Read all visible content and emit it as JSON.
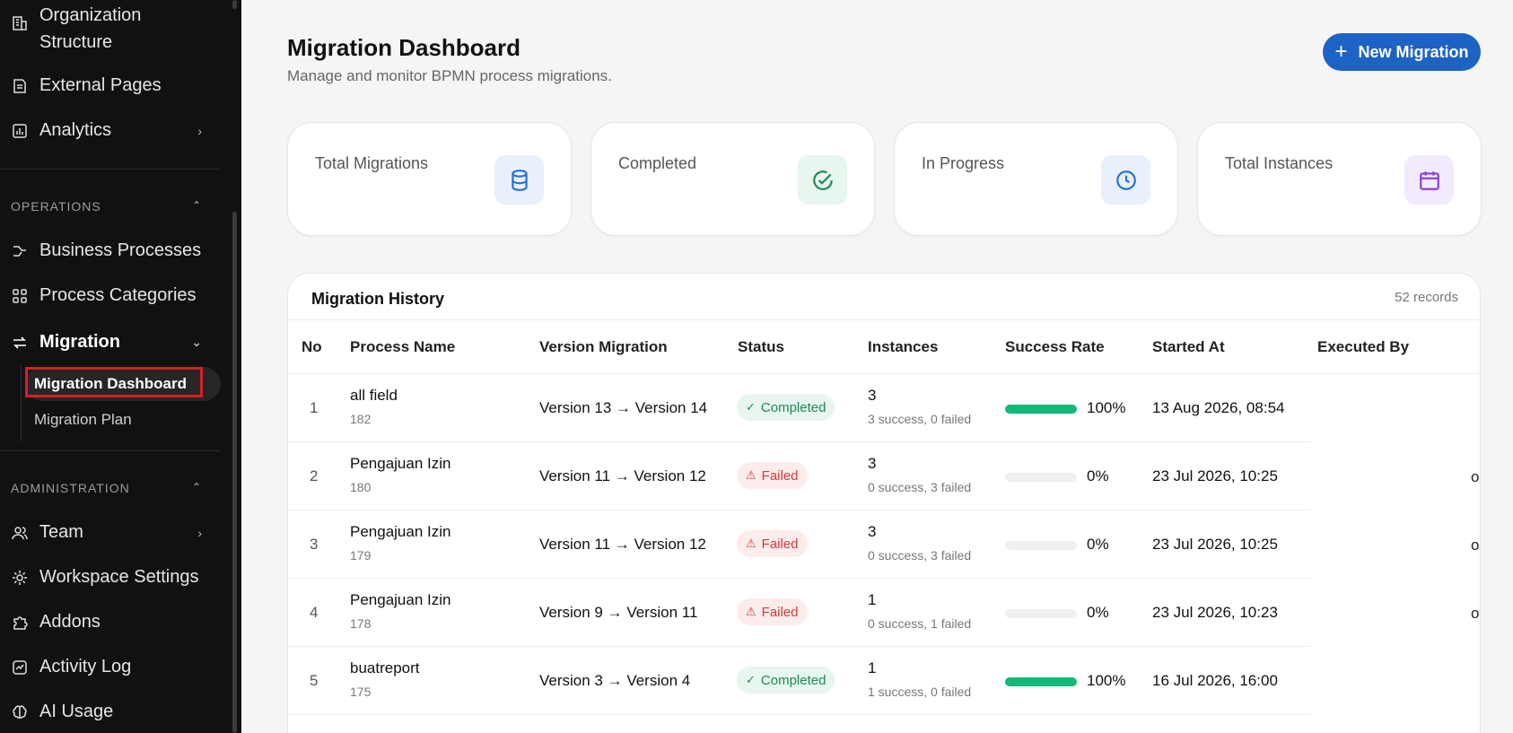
{
  "sidebar": {
    "items_top": [
      {
        "label": "Organization\nStructure",
        "icon": "building-icon"
      },
      {
        "label": "External Pages",
        "icon": "page-icon"
      },
      {
        "label": "Analytics",
        "icon": "chart-icon"
      }
    ],
    "operations_label": "OPERATIONS",
    "operations": [
      {
        "label": "Business Processes",
        "icon": "process-icon"
      },
      {
        "label": "Process Categories",
        "icon": "grid-icon"
      },
      {
        "label": "Migration",
        "icon": "migrate-icon"
      }
    ],
    "migration_sub": [
      "Migration Dashboard",
      "Migration Plan"
    ],
    "administration_label": "ADMINISTRATION",
    "administration": [
      {
        "label": "Team",
        "icon": "team-icon"
      },
      {
        "label": "Workspace Settings",
        "icon": "gear-icon"
      },
      {
        "label": "Addons",
        "icon": "puzzle-icon"
      },
      {
        "label": "Activity Log",
        "icon": "activity-icon"
      },
      {
        "label": "AI Usage",
        "icon": "brain-icon"
      }
    ]
  },
  "header": {
    "title": "Migration Dashboard",
    "subtitle": "Manage and monitor BPMN process migrations.",
    "new_button": "New Migration"
  },
  "stats": [
    {
      "label": "Total Migrations",
      "icon": "database-icon",
      "color": "#2a6fc9",
      "bg": "#e8f0fb"
    },
    {
      "label": "Completed",
      "icon": "check-circle-icon",
      "color": "#1e8a55",
      "bg": "#e7f6ee"
    },
    {
      "label": "In Progress",
      "icon": "clock-icon",
      "color": "#2a6fc9",
      "bg": "#e8f0fb"
    },
    {
      "label": "Total Instances",
      "icon": "calendar-icon",
      "color": "#8a3ddb",
      "bg": "#f2eafd"
    }
  ],
  "history": {
    "title": "Migration History",
    "count": "52 records",
    "columns": [
      "No",
      "Process Name",
      "Version Migration",
      "Status",
      "Instances",
      "Success Rate",
      "Started At",
      "Executed By"
    ],
    "rows": [
      {
        "no": "1",
        "name": "all field",
        "id": "182",
        "version": "Version 13 → Version 14",
        "status": "Completed",
        "instances": "3",
        "instances_sub": "3 success, 0 failed",
        "rate": "100%",
        "rate_value": 100,
        "started": "13 Aug 2026, 08:54",
        "cut": ""
      },
      {
        "no": "2",
        "name": "Pengajuan Izin",
        "id": "180",
        "version": "Version 11 → Version 12",
        "status": "Failed",
        "instances": "3",
        "instances_sub": "0 success, 3 failed",
        "rate": "0%",
        "rate_value": 0,
        "started": "23 Jul 2026, 10:25",
        "cut": "o"
      },
      {
        "no": "3",
        "name": "Pengajuan Izin",
        "id": "179",
        "version": "Version 11 → Version 12",
        "status": "Failed",
        "instances": "3",
        "instances_sub": "0 success, 3 failed",
        "rate": "0%",
        "rate_value": 0,
        "started": "23 Jul 2026, 10:25",
        "cut": "o"
      },
      {
        "no": "4",
        "name": "Pengajuan Izin",
        "id": "178",
        "version": "Version 9 → Version 11",
        "status": "Failed",
        "instances": "1",
        "instances_sub": "0 success, 1 failed",
        "rate": "0%",
        "rate_value": 0,
        "started": "23 Jul 2026, 10:23",
        "cut": "o"
      },
      {
        "no": "5",
        "name": "buatreport",
        "id": "175",
        "version": "Version 3 → Version 4",
        "status": "Completed",
        "instances": "1",
        "instances_sub": "1 success, 0 failed",
        "rate": "100%",
        "rate_value": 100,
        "started": "16 Jul 2026, 16:00",
        "cut": ""
      }
    ]
  }
}
